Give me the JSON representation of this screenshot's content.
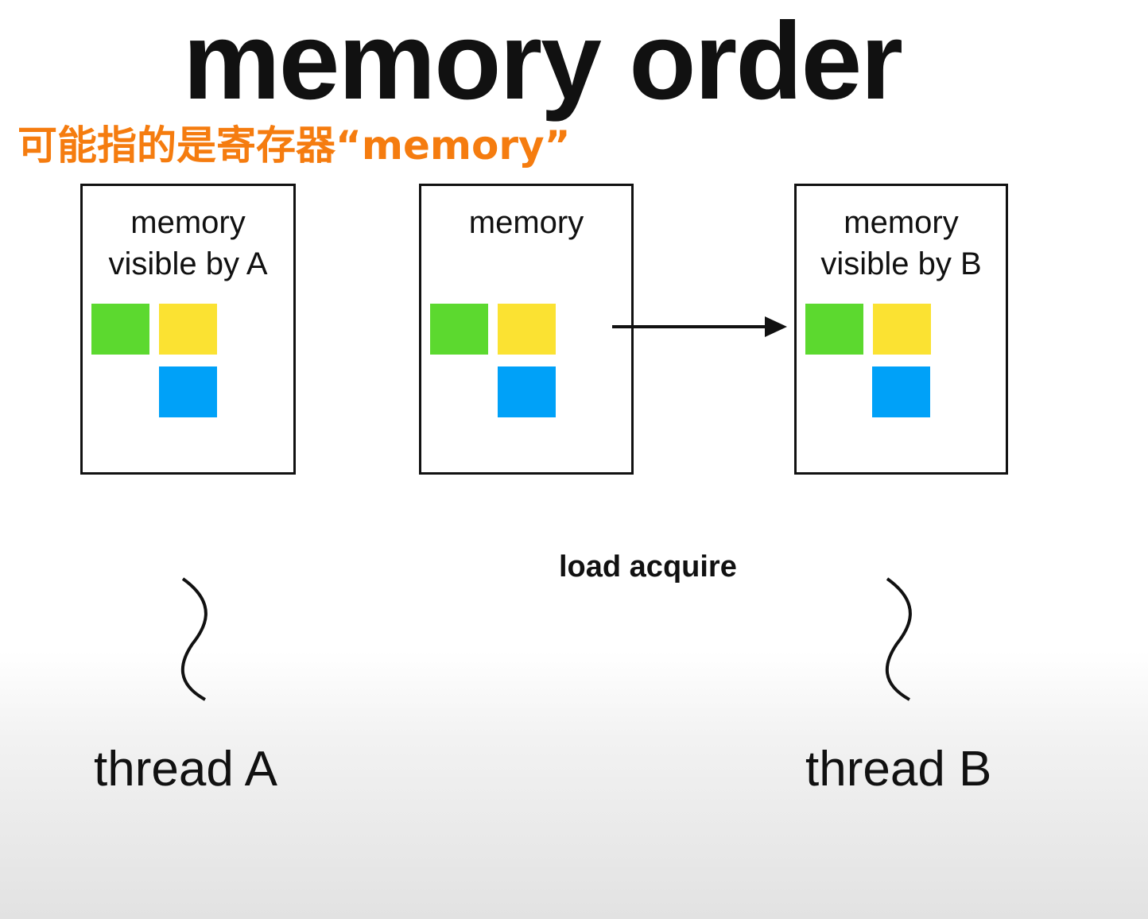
{
  "title": "memory order",
  "annotation": "可能指的是寄存器“memory”",
  "boxes": {
    "a": {
      "line1": "memory",
      "line2": "visible by A"
    },
    "mid": {
      "line1": "memory"
    },
    "b": {
      "line1": "memory",
      "line2": "visible by B"
    }
  },
  "colors": {
    "green": "#5cd92f",
    "yellow": "#fbe232",
    "blue": "#00a1f8",
    "annotation": "#f57c0f"
  },
  "operation_label": "load acquire",
  "threads": {
    "a": "thread A",
    "b": "thread B"
  }
}
